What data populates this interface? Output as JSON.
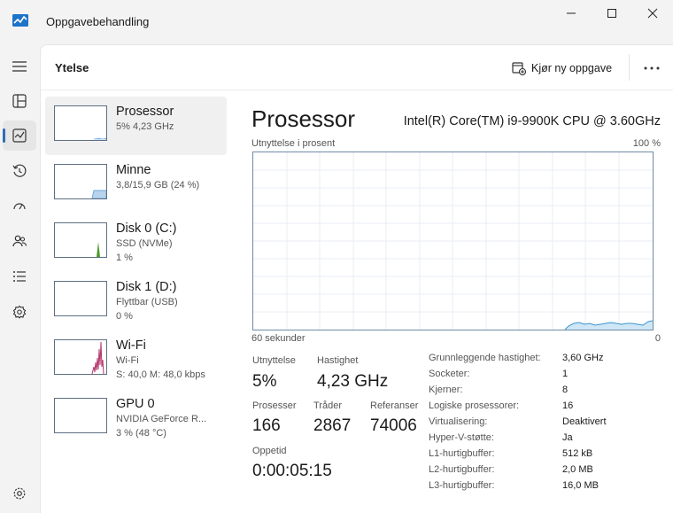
{
  "window": {
    "title": "Oppgavebehandling"
  },
  "header": {
    "page_title": "Ytelse",
    "run_task_label": "Kjør ny oppgave"
  },
  "nav": {
    "items": [
      {
        "icon": "hamburger-menu-icon"
      },
      {
        "icon": "processes-icon"
      },
      {
        "icon": "performance-icon",
        "active": true
      },
      {
        "icon": "app-history-icon"
      },
      {
        "icon": "startup-apps-icon"
      },
      {
        "icon": "users-icon"
      },
      {
        "icon": "details-icon"
      },
      {
        "icon": "services-icon"
      }
    ],
    "settings_icon": "settings-icon"
  },
  "devices": [
    {
      "name": "Prosessor",
      "sub1": "5% 4,23 GHz",
      "sub2": "",
      "selected": true,
      "color": "#1f7ad6",
      "usage_fraction": 0.05
    },
    {
      "name": "Minne",
      "sub1": "3,8/15,9 GB (24 %)",
      "sub2": "",
      "color": "#6ea8d8",
      "usage_fraction": 0.24
    },
    {
      "name": "Disk 0 (C:)",
      "sub1": "SSD (NVMe)",
      "sub2": "1 %",
      "color": "#4c9a2a",
      "usage_fraction": 0.01
    },
    {
      "name": "Disk 1 (D:)",
      "sub1": "Flyttbar (USB)",
      "sub2": "0 %",
      "color": "#4c9a2a",
      "usage_fraction": 0.0
    },
    {
      "name": "Wi-Fi",
      "sub1": "Wi-Fi",
      "sub2": "S: 40,0  M: 48,0 kbps",
      "color": "#b5356e"
    },
    {
      "name": "GPU 0",
      "sub1": "NVIDIA GeForce R...",
      "sub2": "3 % (48 °C)",
      "color": "#1f7ad6",
      "usage_fraction": 0.03
    }
  ],
  "detail": {
    "title": "Prosessor",
    "model": "Intel(R) Core(TM) i9-9900K CPU @ 3.60GHz",
    "graph_label": "Utnyttelse i prosent",
    "graph_max": "100 %",
    "graph_time": "60 sekunder",
    "graph_min": "0",
    "graph_color": "#7fb8dc",
    "stats": {
      "utilization_label": "Utnyttelse",
      "utilization_value": "5%",
      "speed_label": "Hastighet",
      "speed_value": "4,23 GHz",
      "processes_label": "Prosesser",
      "processes_value": "166",
      "threads_label": "Tråder",
      "threads_value": "2867",
      "handles_label": "Referanser",
      "handles_value": "74006",
      "uptime_label": "Oppetid",
      "uptime_value": "0:00:05:15"
    },
    "specs": [
      {
        "key": "Grunnleggende hastighet:",
        "value": "3,60 GHz"
      },
      {
        "key": "Socketer:",
        "value": "1"
      },
      {
        "key": "Kjerner:",
        "value": "8"
      },
      {
        "key": "Logiske prosessorer:",
        "value": "16"
      },
      {
        "key": "Virtualisering:",
        "value": "Deaktivert"
      },
      {
        "key": "Hyper-V-støtte:",
        "value": "Ja"
      },
      {
        "key": "L1-hurtigbuffer:",
        "value": "512 kB"
      },
      {
        "key": "L2-hurtigbuffer:",
        "value": "2,0 MB"
      },
      {
        "key": "L3-hurtigbuffer:",
        "value": "16,0 MB"
      }
    ]
  }
}
